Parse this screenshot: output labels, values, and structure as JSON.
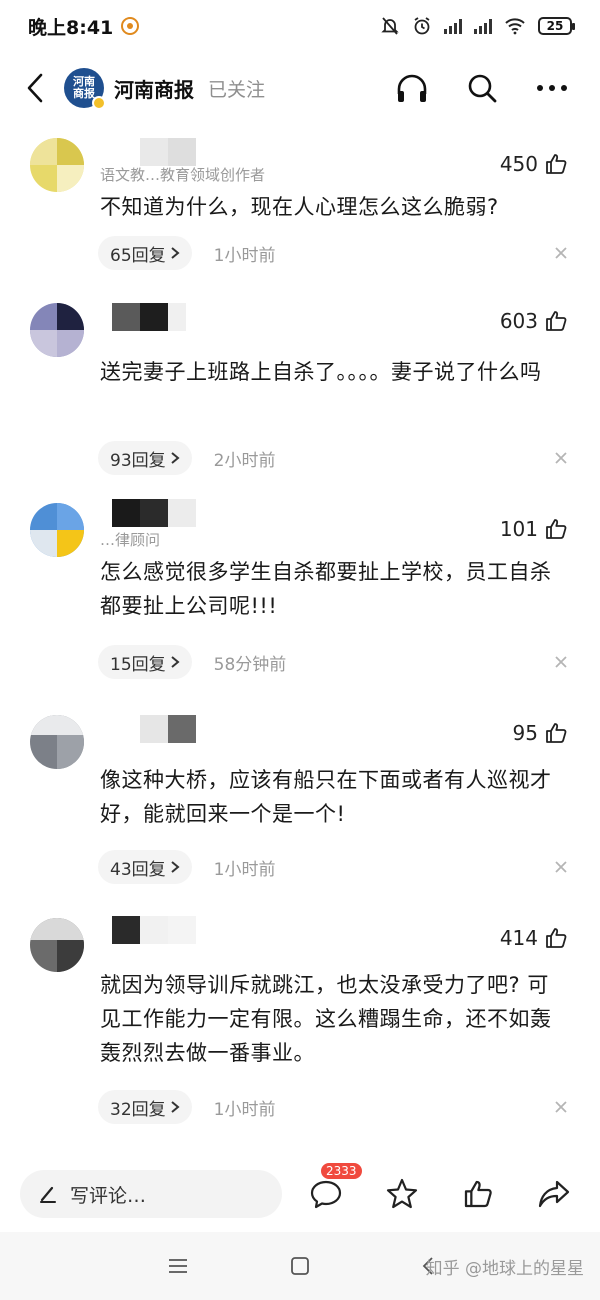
{
  "status_bar": {
    "time": "晚上8:41",
    "battery": "25"
  },
  "header": {
    "account_name": "河南商报",
    "follow_state": "已关注",
    "logo_text": [
      "河南",
      "商报"
    ]
  },
  "comments": [
    {
      "subtitle": "语文教…教育领域创作者",
      "likes": "450",
      "text": "不知道为什么，现在人心理怎么这么脆弱?",
      "replies": "65回复",
      "time": "1小时前"
    },
    {
      "subtitle": "",
      "likes": "603",
      "text": "送完妻子上班路上自杀了。。。。妻子说了什么吗",
      "replies": "93回复",
      "time": "2小时前"
    },
    {
      "subtitle": "…律顾问",
      "likes": "101",
      "text": "怎么感觉很多学生自杀都要扯上学校，员工自杀都要扯上公司呢!!!",
      "replies": "15回复",
      "time": "58分钟前"
    },
    {
      "subtitle": "",
      "likes": "95",
      "text": "像这种大桥，应该有船只在下面或者有人巡视才好，能就回来一个是一个!",
      "replies": "43回复",
      "time": "1小时前"
    },
    {
      "subtitle": "",
      "likes": "414",
      "text": "就因为领导训斥就跳江，也太没承受力了吧? 可见工作能力一定有限。这么糟蹋生命，还不如轰轰烈烈去做一番事业。",
      "replies": "32回复",
      "time": "1小时前"
    }
  ],
  "bottom_bar": {
    "write_placeholder": "写评论…",
    "comment_count": "2333"
  },
  "watermark": "知乎 @地球上的星星",
  "colors": {
    "badge": "#f04a3e",
    "muted": "#9a9a9a",
    "logo": "#1f4f8f"
  }
}
